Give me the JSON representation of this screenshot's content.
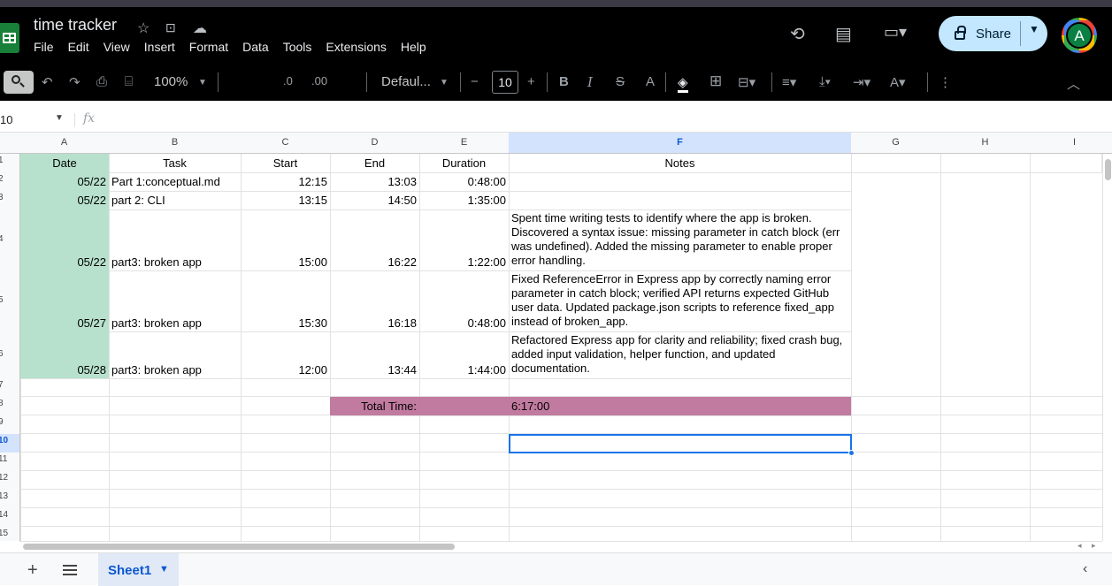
{
  "header": {
    "title": "time tracker",
    "menu": [
      "File",
      "Edit",
      "View",
      "Insert",
      "Format",
      "Data",
      "Tools",
      "Extensions",
      "Help"
    ],
    "share_label": "Share",
    "avatar_letter": "A"
  },
  "toolbar": {
    "zoom": "100%",
    "decrease_decimal": ".0",
    "increase_decimal": ".00",
    "font": "Defaul...",
    "font_size": "10",
    "bold": "B",
    "italic": "I",
    "strike": "S",
    "text_color": "A"
  },
  "formula_bar": {
    "name_box": "10",
    "fx": "fx",
    "value": ""
  },
  "columns": [
    "A",
    "B",
    "C",
    "D",
    "E",
    "F",
    "G",
    "H",
    "I"
  ],
  "rows": [
    "1",
    "2",
    "3",
    "4",
    "5",
    "6",
    "7",
    "8",
    "9",
    "10",
    "11",
    "12",
    "13",
    "14",
    "15"
  ],
  "selected_col": "F",
  "selected_row": "10",
  "table": {
    "headers": {
      "date": "Date",
      "task": "Task",
      "start": "Start",
      "end": "End",
      "duration": "Duration",
      "notes": "Notes"
    },
    "entries": [
      {
        "date": "05/22",
        "task": "Part 1:conceptual.md",
        "start": "12:15",
        "end": "13:03",
        "duration": "0:48:00",
        "notes": ""
      },
      {
        "date": "05/22",
        "task": "part 2: CLI",
        "start": "13:15",
        "end": "14:50",
        "duration": "1:35:00",
        "notes": ""
      },
      {
        "date": "05/22",
        "task": "part3: broken app",
        "start": "15:00",
        "end": "16:22",
        "duration": "1:22:00",
        "notes": "Spent time writing tests to identify where the app is broken. Discovered a syntax issue: missing parameter in catch block (err was undefined). Added the missing parameter to enable proper error handling."
      },
      {
        "date": "05/27",
        "task": "part3: broken app",
        "start": "15:30",
        "end": "16:18",
        "duration": "0:48:00",
        "notes": "Fixed ReferenceError in Express app by correctly naming error parameter in catch block; verified API returns expected GitHub user data. Updated package.json scripts to reference fixed_app instead of broken_app."
      },
      {
        "date": "05/28",
        "task": "part3: broken app",
        "start": "12:00",
        "end": "13:44",
        "duration": "1:44:00",
        "notes": "Refactored Express app for clarity and reliability; fixed crash bug, added input validation, helper function, and updated documentation."
      }
    ],
    "total_label": "Total Time:",
    "total_value": "6:17:00"
  },
  "sheets": [
    {
      "name": "Sheet1",
      "active": true
    }
  ],
  "colors": {
    "date_fill": "#b7e1cd",
    "total_fill": "#c27ba0",
    "accent": "#1a73e8"
  }
}
